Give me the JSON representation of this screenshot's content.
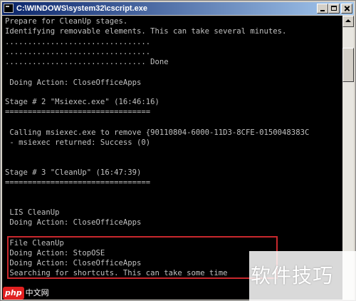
{
  "window": {
    "title": "C:\\WINDOWS\\system32\\cscript.exe"
  },
  "console": {
    "lines": [
      "Prepare for CleanUp stages.",
      "Identifying removable elements. This can take several minutes.",
      "................................",
      "................................",
      "............................... Done",
      "",
      " Doing Action: CloseOfficeApps",
      "",
      "Stage # 2 \"Msiexec.exe\" (16:46:16)",
      "================================",
      "",
      " Calling msiexec.exe to remove {90110804-6000-11D3-8CFE-0150048383C",
      " - msiexec returned: Success (0)",
      "",
      "",
      "Stage # 3 \"CleanUp\" (16:47:39)",
      "================================",
      "",
      "",
      " LIS CleanUp",
      " Doing Action: CloseOfficeApps",
      "",
      " File CleanUp",
      " Doing Action: StopOSE",
      " Doing Action: CloseOfficeApps",
      " Searching for shortcuts. This can take some time"
    ]
  },
  "watermark": {
    "text": "软件技巧",
    "logo_badge": "php",
    "logo_text": "中文网"
  },
  "colors": {
    "console_bg": "#000000",
    "console_fg": "#c0c0c0",
    "title_bar": "#0a246a",
    "highlight_border": "#c8282d"
  },
  "icons": {
    "title": "console-window-icon",
    "minimize": "minimize-icon",
    "maximize": "maximize-icon",
    "close": "close-icon",
    "scroll_up": "arrow-up-icon"
  }
}
